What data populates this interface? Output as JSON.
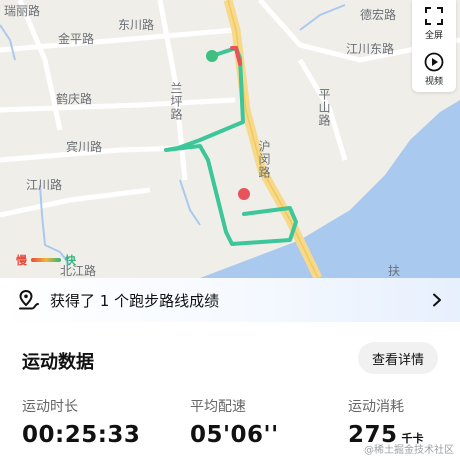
{
  "map": {
    "labels": {
      "ruili": "瑞丽路",
      "jinping": "金平路",
      "dongchuan": "东川路",
      "dehong": "德宏路",
      "jiangchuan_east": "江川东路",
      "heqing": "鹤庆路",
      "lanping": "兰坪路",
      "pingshan": "平山路",
      "binchuan": "宾川路",
      "humin": "沪闵路",
      "jiangchuan": "江川路",
      "beichuan": "北江路",
      "fu": "扶"
    },
    "controls": {
      "fullscreen_label": "全屏",
      "video_label": "视频"
    },
    "legend": {
      "slow": "慢",
      "fast": "快"
    },
    "colors": {
      "route": "#3cc69a",
      "start": "#3cbf7f",
      "end": "#e8525a",
      "river": "#a9c9ef"
    }
  },
  "banner": {
    "text": "获得了 1 个跑步路线成绩"
  },
  "stats": {
    "title": "运动数据",
    "details_button": "查看详情",
    "duration": {
      "label": "运动时长",
      "value": "00:25:33"
    },
    "pace": {
      "label": "平均配速",
      "value": "05'06''"
    },
    "calories": {
      "label": "运动消耗",
      "value": "275",
      "unit": "千卡"
    }
  },
  "watermark": "@稀土掘金技术社区"
}
